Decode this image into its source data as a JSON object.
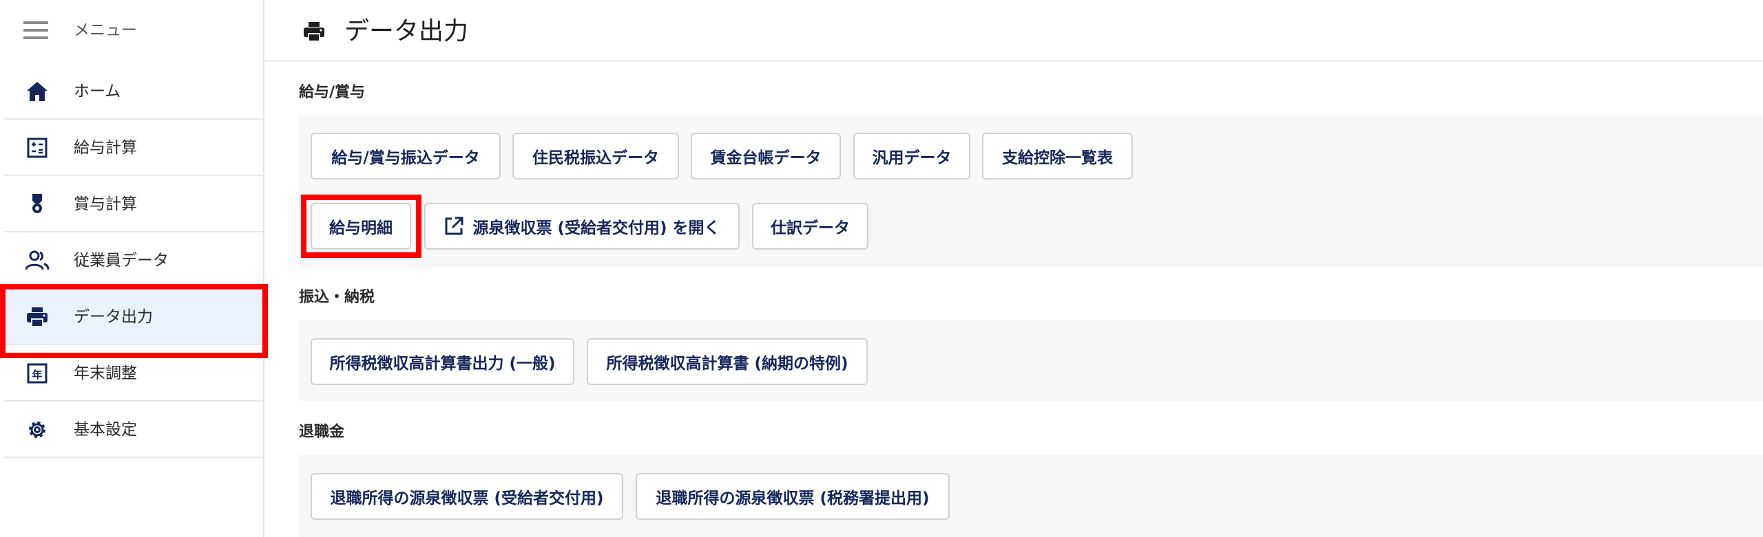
{
  "sidebar": {
    "menu_label": "メニュー",
    "items": [
      {
        "label": "ホーム",
        "icon": "home-icon"
      },
      {
        "label": "給与計算",
        "icon": "calculator-icon"
      },
      {
        "label": "賞与計算",
        "icon": "medal-icon"
      },
      {
        "label": "従業員データ",
        "icon": "people-icon"
      },
      {
        "label": "データ出力",
        "icon": "printer-icon",
        "active": true
      },
      {
        "label": "年末調整",
        "icon": "calendar-year-icon"
      },
      {
        "label": "基本設定",
        "icon": "gear-icon"
      }
    ]
  },
  "header": {
    "title": "データ出力",
    "icon": "printer-icon"
  },
  "sections": {
    "salary": {
      "title": "給与/賞与",
      "buttons": [
        "給与/賞与振込データ",
        "住民税振込データ",
        "賃金台帳データ",
        "汎用データ",
        "支給控除一覧表",
        "給与明細",
        "源泉徴収票 (受給者交付用) を開く",
        "仕訳データ"
      ]
    },
    "transfer": {
      "title": "振込・納税",
      "buttons": [
        "所得税徴収高計算書出力 (一般)",
        "所得税徴収高計算書 (納期の特例)"
      ]
    },
    "retirement": {
      "title": "退職金",
      "buttons": [
        "退職所得の源泉徴収票 (受給者交付用)",
        "退職所得の源泉徴収票 (税務署提出用)"
      ]
    }
  },
  "colors": {
    "accent": "#16265a",
    "highlight": "#ff0000",
    "active_bg": "#eaf3fd",
    "panel_bg": "#f7f7f7"
  }
}
